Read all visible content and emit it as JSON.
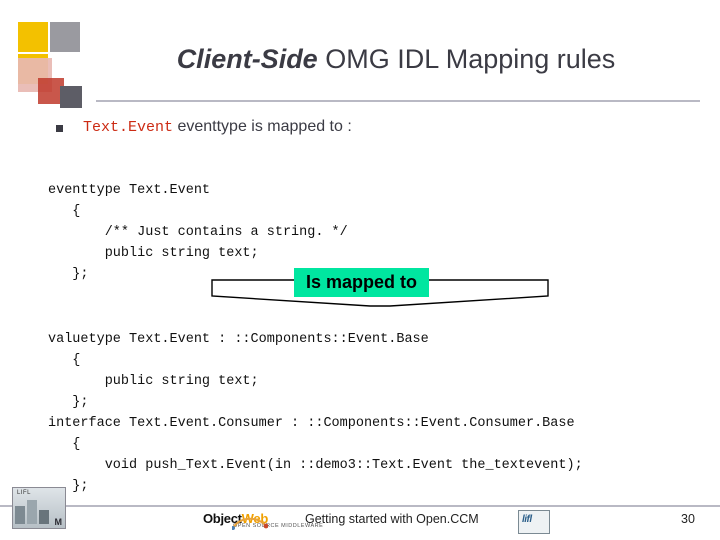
{
  "slide": {
    "title": {
      "emphasis": "Client-Side",
      "rest": " OMG IDL Mapping rules"
    },
    "bullet": {
      "code_term": "Text.Event",
      "text": " eventtype is mapped to :"
    },
    "code_top": "eventtype Text.Event\n   {\n       /** Just contains a string. */\n       public string text;\n   };",
    "banner_label": "Is mapped to",
    "code_bottom": "valuetype Text.Event : ::Components::Event.Base\n   {\n       public string text;\n   };\ninterface Text.Event.Consumer : ::Components::Event.Consumer.Base\n   {\n       void push_Text.Event(in ::demo3::Text.Event the_textevent);\n   };",
    "footer": {
      "text": "Getting started with Open.CCM",
      "page_number": "30",
      "objectweb_name": "Object",
      "objectweb_accent": "Web",
      "objectweb_sub": "OPEN SOURCE MIDDLEWARE",
      "lifl_label": "LIFL",
      "lifl_mark": "M",
      "lifl_br": "lifl"
    },
    "colors": {
      "code_red": "#cc2b14",
      "banner_bg": "#00e6a0",
      "title_color": "#3b3b44",
      "accent_yellow": "#f3c100"
    }
  }
}
